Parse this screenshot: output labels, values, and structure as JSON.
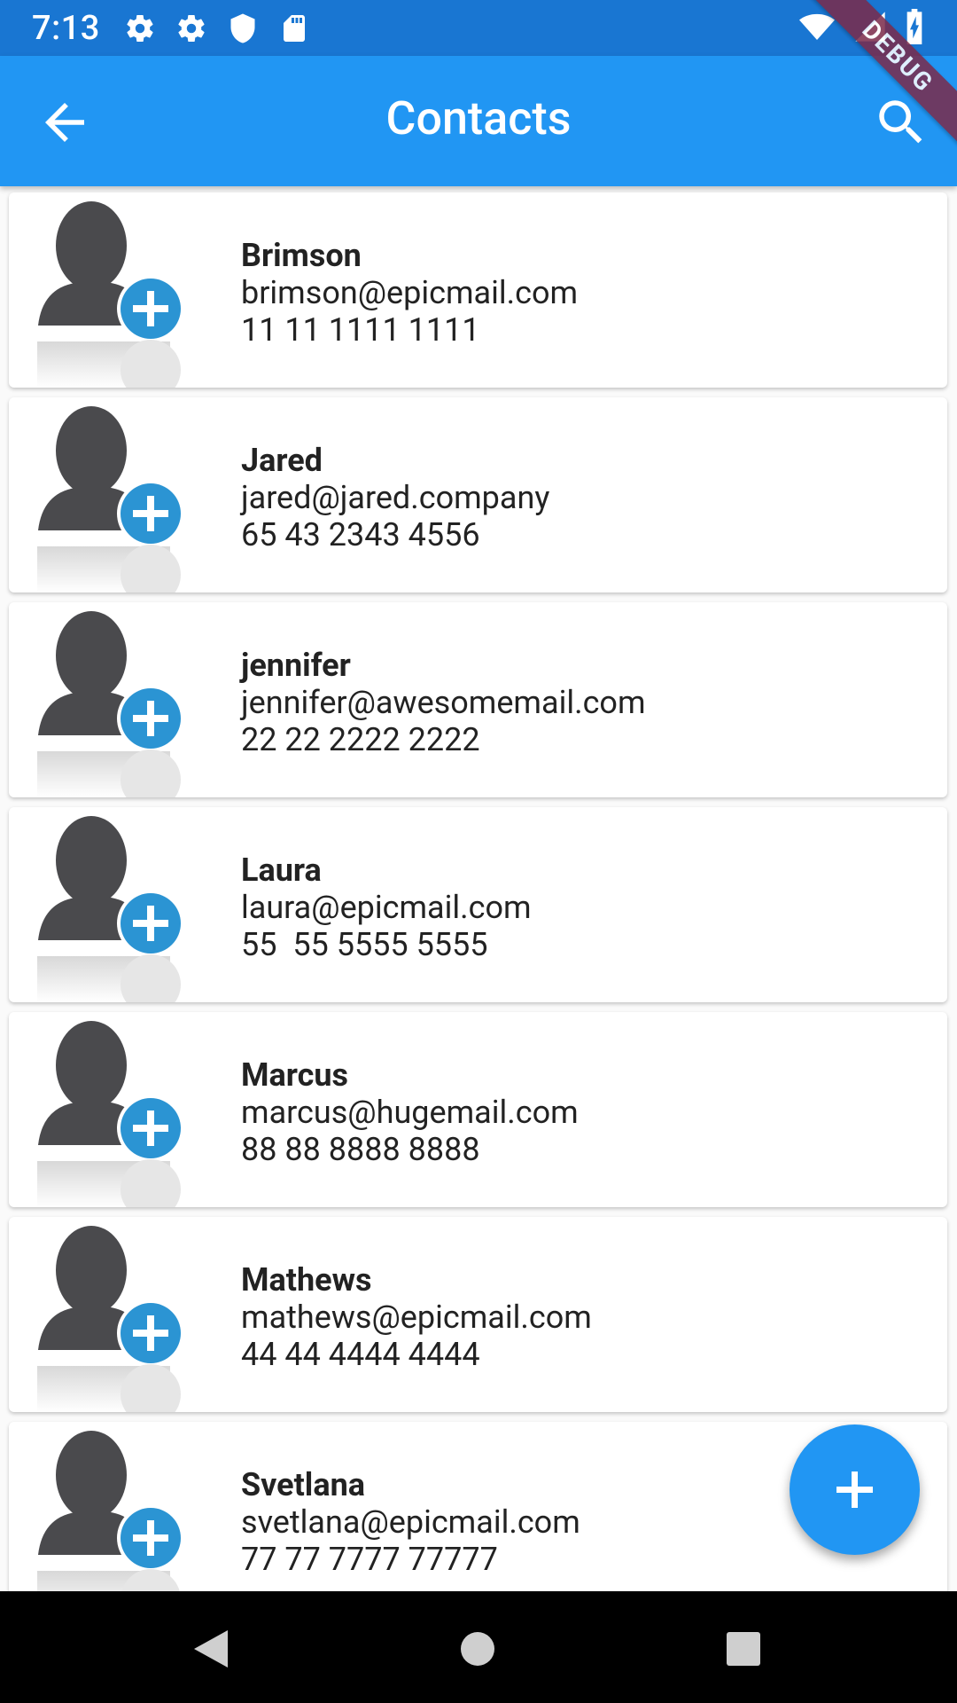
{
  "status_bar": {
    "time": "7:13",
    "icons": [
      "gear-icon",
      "gear-icon",
      "shield-icon",
      "sd-card-icon",
      "wifi-icon",
      "signal-icon",
      "battery-charging-icon"
    ]
  },
  "app_bar": {
    "title": "Contacts",
    "debug_banner": "DEBUG",
    "color": "#2196F3",
    "status_color": "#1976D2"
  },
  "contacts": [
    {
      "name": "Brimson",
      "email": "brimson@epicmail.com",
      "phone": "11 11 1111 1111"
    },
    {
      "name": "Jared",
      "email": "jared@jared.company",
      "phone": "65 43 2343 4556"
    },
    {
      "name": "jennifer",
      "email": "jennifer@awesomemail.com",
      "phone": "22 22 2222 2222"
    },
    {
      "name": "Laura",
      "email": "laura@epicmail.com",
      "phone": "55  55 5555 5555"
    },
    {
      "name": "Marcus",
      "email": "marcus@hugemail.com",
      "phone": "88 88 8888 8888"
    },
    {
      "name": "Mathews",
      "email": "mathews@epicmail.com",
      "phone": "44 44 4444 4444"
    },
    {
      "name": "Svetlana",
      "email": "svetlana@epicmail.com",
      "phone": "77 77 7777 77777"
    }
  ],
  "fab": {
    "icon": "plus-icon"
  },
  "nav_bar": {
    "icons": [
      "back-triangle-icon",
      "home-circle-icon",
      "recents-square-icon"
    ]
  }
}
